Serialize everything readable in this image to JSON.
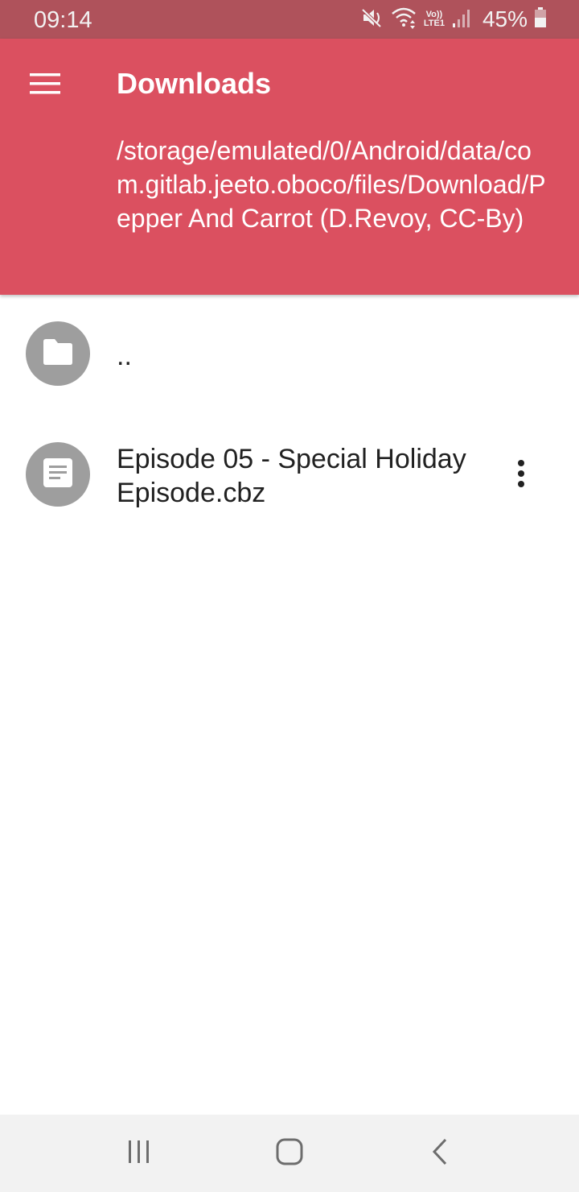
{
  "status_bar": {
    "time": "09:14",
    "network_label_top": "Vo))",
    "network_label_bottom": "LTE1",
    "battery_percent": "45%",
    "icons": [
      "mute-icon",
      "wifi-icon",
      "volte-icon",
      "signal-icon",
      "battery-icon"
    ]
  },
  "app_bar": {
    "title": "Downloads",
    "path": "/storage/emulated/0/Android/data/com.gitlab.jeeto.oboco/files/Download/Pepper And Carrot (D.Revoy, CC-By)",
    "background_color": "#db5060",
    "menu_icon": "hamburger-menu-icon"
  },
  "file_list": {
    "items": [
      {
        "name": "..",
        "icon": "folder-icon",
        "kind": "parent-folder"
      },
      {
        "name": "Episode 05 - Special Holiday Episode.cbz",
        "icon": "document-icon",
        "kind": "file",
        "menu_icon": "more-vert-icon"
      }
    ]
  },
  "nav_bar": {
    "buttons": [
      "recents-icon",
      "home-icon",
      "back-icon"
    ]
  }
}
